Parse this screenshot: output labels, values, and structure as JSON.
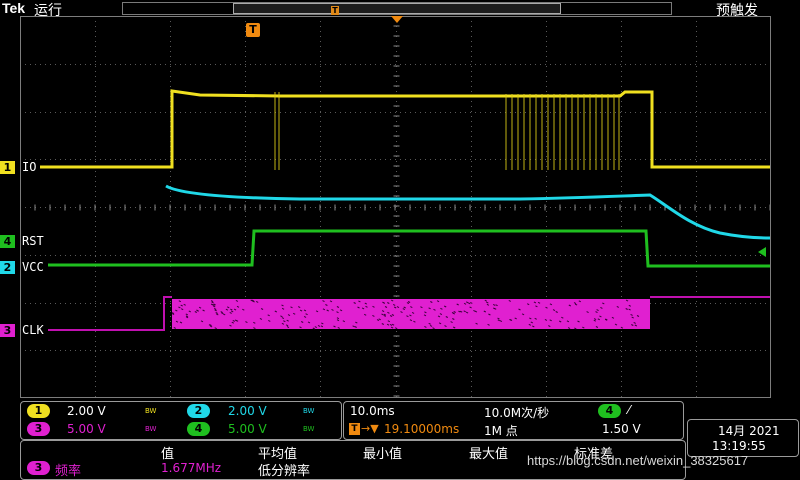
{
  "header": {
    "brand": "Tek",
    "run_state": "运行",
    "trigger_state": "预触发",
    "timeline_trigger_marker": "T"
  },
  "trigger_marker": "T",
  "channels": [
    {
      "id": "1",
      "label": "IO",
      "color": "#f0e020"
    },
    {
      "id": "4",
      "label": "RST",
      "color": "#1fbf1f"
    },
    {
      "id": "2",
      "label": "VCC",
      "color": "#20d8e8"
    },
    {
      "id": "3",
      "label": "CLK",
      "color": "#e020d0"
    }
  ],
  "readout": {
    "ch1": {
      "badge": "1",
      "scale": "2.00 V",
      "bw": "BW",
      "color": "#f0e020"
    },
    "ch2": {
      "badge": "2",
      "scale": "2.00 V",
      "bw": "BW",
      "color": "#20d8e8"
    },
    "ch3": {
      "badge": "3",
      "scale": "5.00 V",
      "bw": "BW",
      "color": "#e020d0"
    },
    "ch4": {
      "badge": "4",
      "scale": "5.00 V",
      "bw": "BW",
      "color": "#1fbf1f"
    }
  },
  "horizontal": {
    "time_div": "10.0ms",
    "sample_rate": "10.0M次/秒",
    "trig_delay": "19.10000ms",
    "record_length": "1M 点",
    "trig_source": "4",
    "trig_slope": "⁄",
    "trig_level": "1.50 V"
  },
  "clock": {
    "date": "14月 2021",
    "time": "13:19:55"
  },
  "measure": {
    "headers": [
      "值",
      "平均值",
      "最小值",
      "最大值",
      "标准差"
    ],
    "row_badge": "3",
    "row_name": "频率",
    "row_value": "1.677MHz",
    "row_note": "低分辨率"
  },
  "watermark": "https://blog.csdn.net/weixin_38325617"
}
